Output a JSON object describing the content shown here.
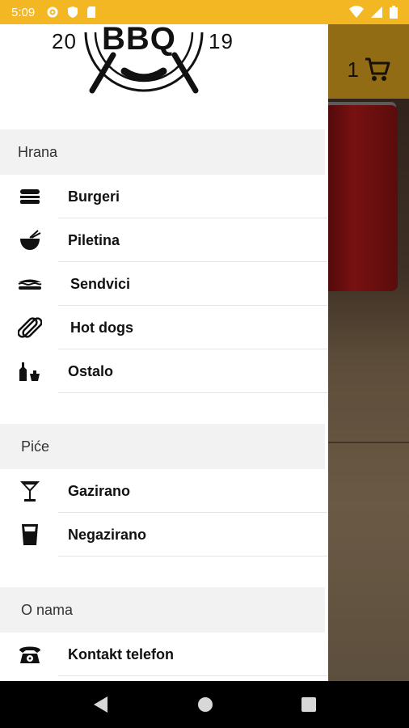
{
  "status_bar": {
    "time": "5:09"
  },
  "header": {
    "cart_count": "1"
  },
  "logo": {
    "brand": "BBQ",
    "year_left": "20",
    "year_right": "19"
  },
  "sections": [
    {
      "title": "Hrana",
      "items": [
        "Burgeri",
        "Piletina",
        "Sendvici",
        "Hot dogs",
        "Ostalo"
      ]
    },
    {
      "title": "Piće",
      "items": [
        "Gazirano",
        "Negazirano"
      ]
    },
    {
      "title": "O nama",
      "items": [
        "Kontakt telefon"
      ]
    }
  ],
  "icons": {
    "burgeri": "burger-icon",
    "piletina": "bowl-icon",
    "sendvici": "sandwich-icon",
    "hot_dogs": "hot-dog-icon",
    "ostalo": "bottles-icon",
    "gazirano": "cocktail-glass-icon",
    "negazirano": "cup-icon",
    "kontakt": "telephone-icon"
  },
  "colors": {
    "status_bar": "#f3b723",
    "toolbar": "#ac7e19",
    "section_bg": "#f2f2f2"
  }
}
